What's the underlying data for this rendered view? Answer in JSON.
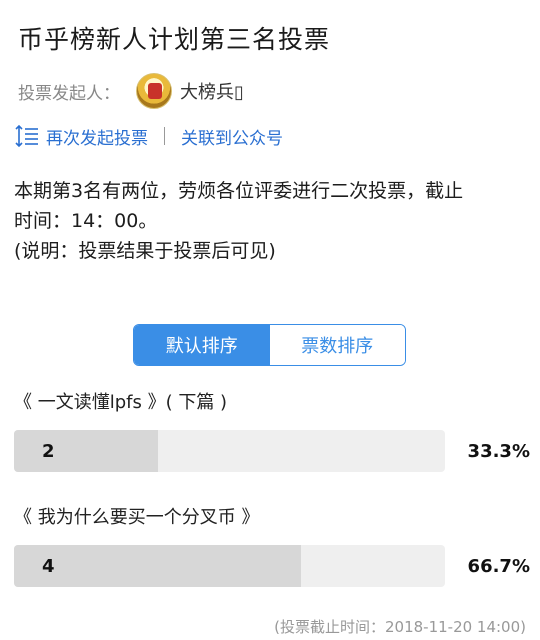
{
  "title": "币乎榜新人计划第三名投票",
  "initiator": {
    "label": "投票发起人：",
    "name": "大榜兵▯"
  },
  "actions": {
    "revote": "再次发起投票",
    "link_account": "关联到公众号"
  },
  "description": {
    "line1": "本期第3名有两位，劳烦各位评委进行二次投票，截止",
    "line2": "时间：14：00。",
    "line3": "(说明：投票结果于投票后可见)"
  },
  "sort": {
    "default_label": "默认排序",
    "votes_label": "票数排序",
    "active": "default"
  },
  "options": [
    {
      "title": "《 一文读懂lpfs 》( 下篇 )",
      "count": "2",
      "percent_label": "33.3%",
      "fraction": 0.333
    },
    {
      "title": "《 我为什么要买一个分叉币 》",
      "count": "4",
      "percent_label": "66.7%",
      "fraction": 0.667
    }
  ],
  "footer": "(投票截止时间：2018-11-20 14:00)",
  "colors": {
    "accent": "#3a8ee6",
    "link": "#2a6fd1",
    "bar_bg": "#efefef",
    "bar_fill": "#d7d7d7"
  }
}
